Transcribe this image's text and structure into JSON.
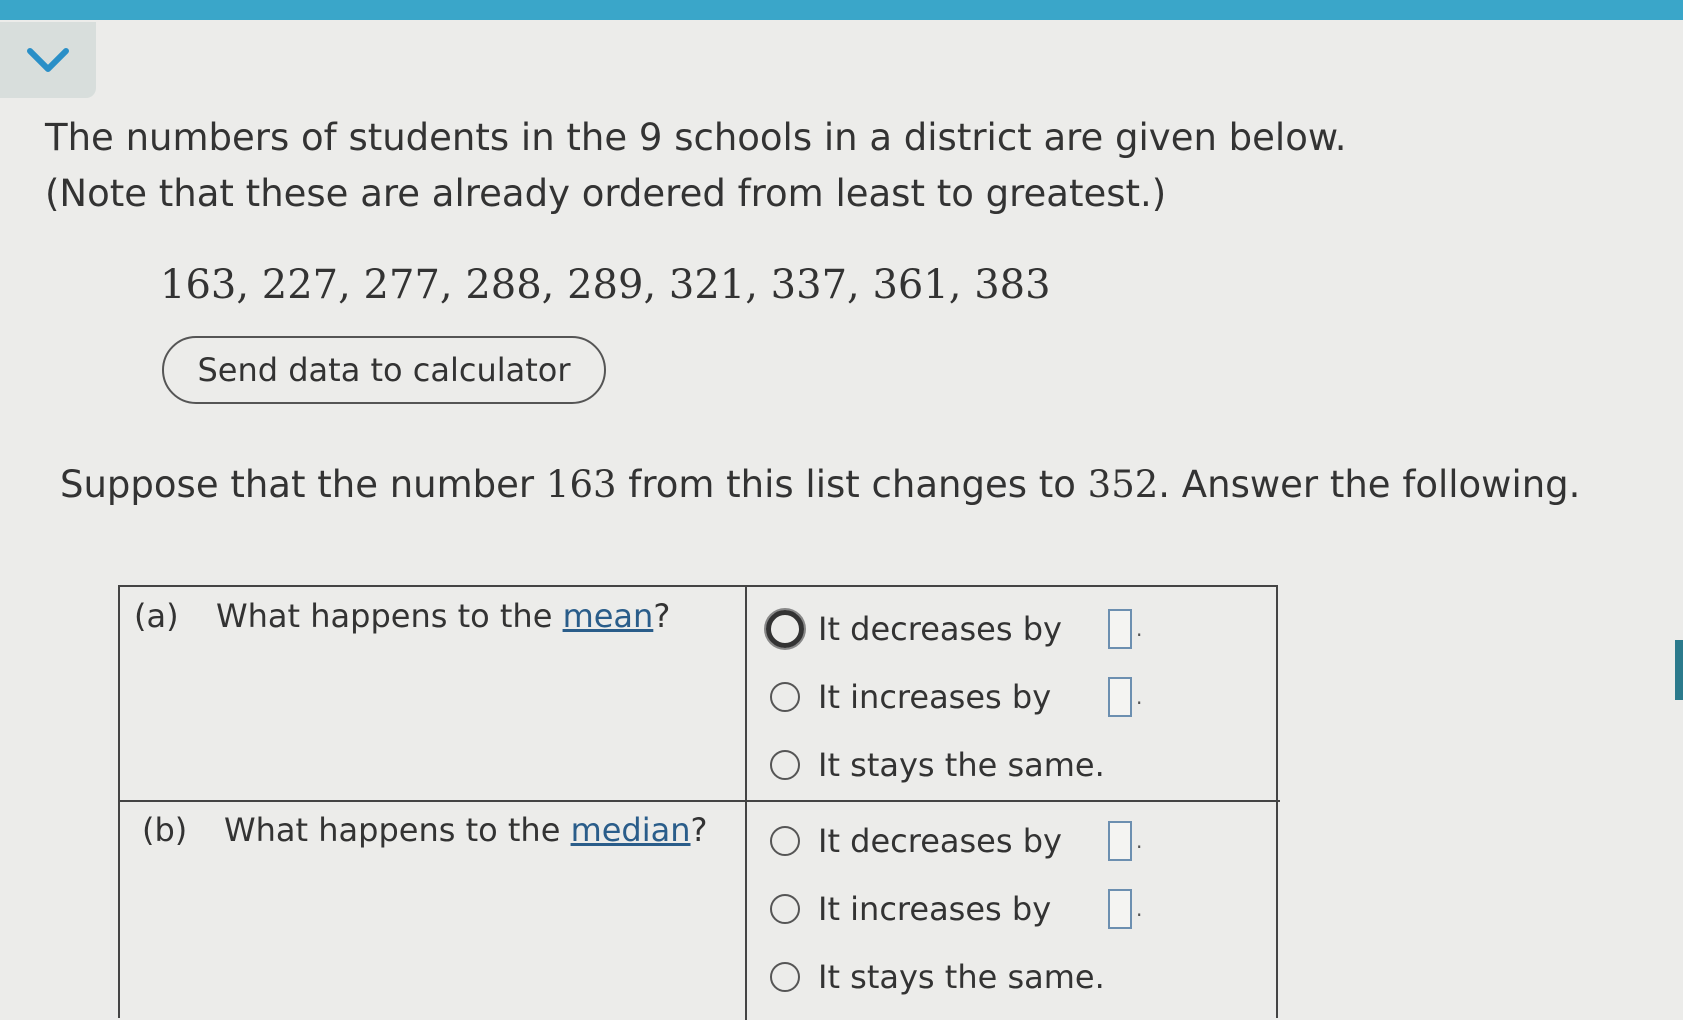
{
  "colors": {
    "top_bar": "#3aa6c9",
    "link": "#2a5d8a",
    "answer_box_border": "#6c8fb0"
  },
  "collapse_toggle": {
    "icon": "chevron-down-icon"
  },
  "prompt": {
    "line1": "The numbers of students in the 9 schools in a district are given below.",
    "line2": "(Note that these are already ordered from least to greatest.)"
  },
  "data_list": "163, 227, 277, 288, 289, 321, 337, 361, 383",
  "send_button_label": "Send data to calculator",
  "suppose": {
    "before": "Suppose that the number ",
    "from_value": "163",
    "middle": " from this list changes to ",
    "to_value": "352",
    "after": ". Answer the following."
  },
  "questions": [
    {
      "tag": "(a)",
      "text_before": "What happens to the ",
      "term": "mean",
      "text_after": "?",
      "options": [
        {
          "label": "It decreases by",
          "has_input": true,
          "input_value": "",
          "period": "."
        },
        {
          "label": "It increases by",
          "has_input": true,
          "input_value": "",
          "period": "."
        },
        {
          "label": "It stays the same.",
          "has_input": false
        }
      ]
    },
    {
      "tag": "(b)",
      "text_before": "What happens to the ",
      "term": "median",
      "text_after": "?",
      "options": [
        {
          "label": "It decreases by",
          "has_input": true,
          "input_value": "",
          "period": "."
        },
        {
          "label": "It increases by",
          "has_input": true,
          "input_value": "",
          "period": "."
        },
        {
          "label": "It stays the same.",
          "has_input": false
        }
      ]
    }
  ]
}
